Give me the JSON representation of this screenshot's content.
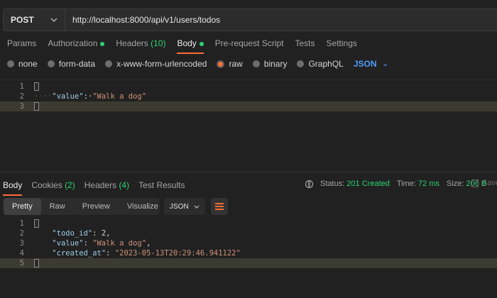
{
  "request": {
    "method": "POST",
    "url": "http://localhost:8000/api/v1/users/todos"
  },
  "request_tabs": [
    {
      "label": "Params"
    },
    {
      "label": "Authorization"
    },
    {
      "label": "Headers",
      "count": "(10)"
    },
    {
      "label": "Body"
    },
    {
      "label": "Pre-request Script"
    },
    {
      "label": "Tests"
    },
    {
      "label": "Settings"
    }
  ],
  "body_types": [
    "none",
    "form-data",
    "x-www-form-urlencoded",
    "raw",
    "binary",
    "GraphQL"
  ],
  "body_format": "JSON",
  "request_body": {
    "line_numbers": [
      "1",
      "2",
      "3"
    ],
    "key": "\"value\"",
    "value": "\"Walk a dog\""
  },
  "response_tabs": [
    {
      "label": "Body"
    },
    {
      "label": "Cookies",
      "count": "(2)"
    },
    {
      "label": "Headers",
      "count": "(4)"
    },
    {
      "label": "Test Results"
    }
  ],
  "response_status": {
    "status_label": "Status:",
    "status_value": "201 Created",
    "time_label": "Time:",
    "time_value": "72 ms",
    "size_label": "Size:",
    "size_value": "206 B",
    "save_label": "Save"
  },
  "view_modes": [
    "Pretty",
    "Raw",
    "Preview",
    "Visualize"
  ],
  "response_format": "JSON",
  "response_body": {
    "line_numbers": [
      "1",
      "2",
      "3",
      "4",
      "5"
    ],
    "todo_id_key": "\"todo_id\"",
    "todo_id_value": "2",
    "value_key": "\"value\"",
    "value_value": "\"Walk a dog\"",
    "created_at_key": "\"created_at\"",
    "created_at_value": "\"2023-05-13T20:29:46.941122\""
  },
  "colors": {
    "accent": "#ff6c37",
    "status_green": "#2bd272",
    "link_blue": "#4f9cf6",
    "background": "#212121"
  }
}
